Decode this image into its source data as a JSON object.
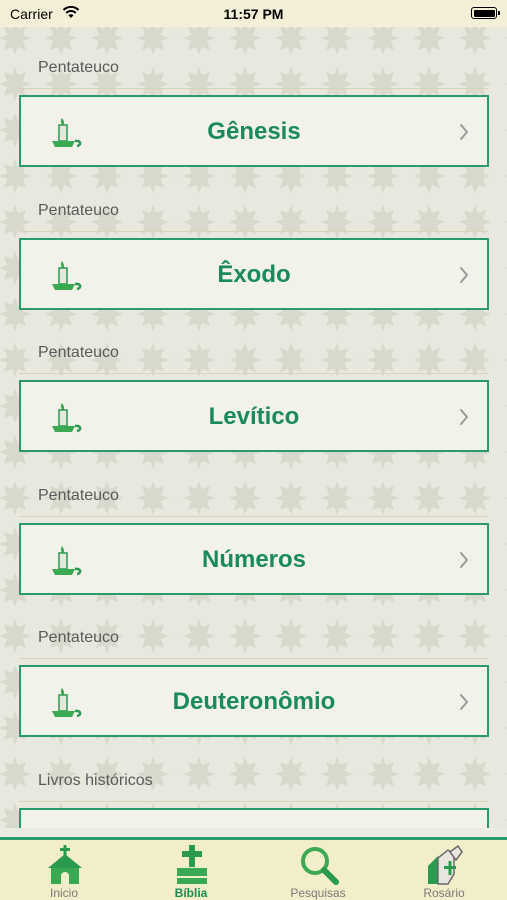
{
  "status_bar": {
    "carrier": "Carrier",
    "time": "11:57 PM"
  },
  "sections": [
    {
      "header": "Pentateuco",
      "title": "Gênesis"
    },
    {
      "header": "Pentateuco",
      "title": "Êxodo"
    },
    {
      "header": "Pentateuco",
      "title": "Levítico"
    },
    {
      "header": "Pentateuco",
      "title": "Números"
    },
    {
      "header": "Pentateuco",
      "title": "Deuteronômio"
    },
    {
      "header": "Livros históricos",
      "title": ""
    }
  ],
  "tabs": [
    {
      "label": "Inicio",
      "icon": "church-icon",
      "active": false
    },
    {
      "label": "Bíblia",
      "icon": "bible-cross-icon",
      "active": true
    },
    {
      "label": "Pesquisas",
      "icon": "magnifier-icon",
      "active": false
    },
    {
      "label": "Rosário",
      "icon": "praying-hands-icon",
      "active": false
    }
  ],
  "colors": {
    "accent": "#2a9a6a",
    "title_green": "#1a8a5e",
    "tab_bar": "#f3eeca"
  }
}
